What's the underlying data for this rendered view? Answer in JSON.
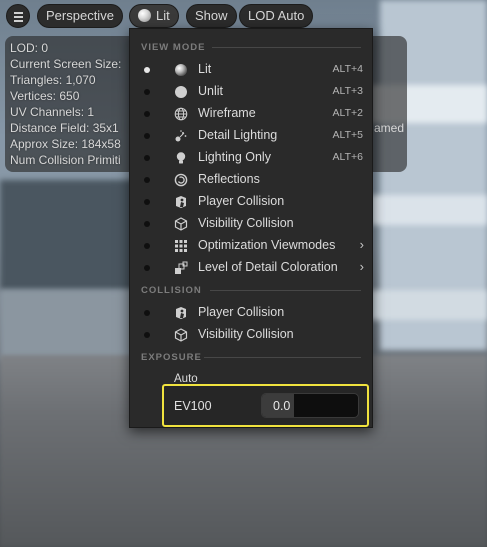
{
  "toolbar": {
    "perspective": "Perspective",
    "lit": "Lit",
    "show": "Show",
    "lod": "LOD Auto"
  },
  "stats": {
    "lod": "LOD:  0",
    "screen_size": "Current Screen Size:",
    "triangles": "Triangles:  1,070",
    "vertices": "Vertices:  650",
    "uv_channels": "UV Channels:  1",
    "distance_field": "Distance Field:  35x1",
    "approx_size": "Approx Size:  184x58",
    "num_collision": "Num Collision Primiti",
    "right_fragment": "amed"
  },
  "menu": {
    "view_mode_header": "VIEW MODE",
    "view_modes": [
      {
        "label": "Lit",
        "shortcut": "ALT+4",
        "icon": "lit-sphere-icon",
        "selected": true
      },
      {
        "label": "Unlit",
        "shortcut": "ALT+3",
        "icon": "unlit-sphere-icon",
        "selected": false
      },
      {
        "label": "Wireframe",
        "shortcut": "ALT+2",
        "icon": "wireframe-globe-icon",
        "selected": false
      },
      {
        "label": "Detail Lighting",
        "shortcut": "ALT+5",
        "icon": "detail-lighting-icon",
        "selected": false
      },
      {
        "label": "Lighting Only",
        "shortcut": "ALT+6",
        "icon": "lightbulb-icon",
        "selected": false
      },
      {
        "label": "Reflections",
        "shortcut": "",
        "icon": "reflections-icon",
        "selected": false
      },
      {
        "label": "Player Collision",
        "shortcut": "",
        "icon": "player-collision-icon",
        "selected": false
      },
      {
        "label": "Visibility Collision",
        "shortcut": "",
        "icon": "visibility-collision-icon",
        "selected": false
      },
      {
        "label": "Optimization Viewmodes",
        "shortcut": "",
        "icon": "optimization-grid-icon",
        "selected": false,
        "submenu": true
      },
      {
        "label": "Level of Detail Coloration",
        "shortcut": "",
        "icon": "lod-coloration-icon",
        "selected": false,
        "submenu": true
      }
    ],
    "collision_header": "COLLISION",
    "collision": [
      {
        "label": "Player Collision",
        "icon": "player-collision-icon"
      },
      {
        "label": "Visibility Collision",
        "icon": "visibility-collision-icon"
      }
    ],
    "exposure_header": "EXPOSURE",
    "exposure_auto": "Auto",
    "ev100_label": "EV100",
    "ev100_value": "0.0",
    "submenu_arrow": "›",
    "highlight_color": "#f0e23e"
  }
}
